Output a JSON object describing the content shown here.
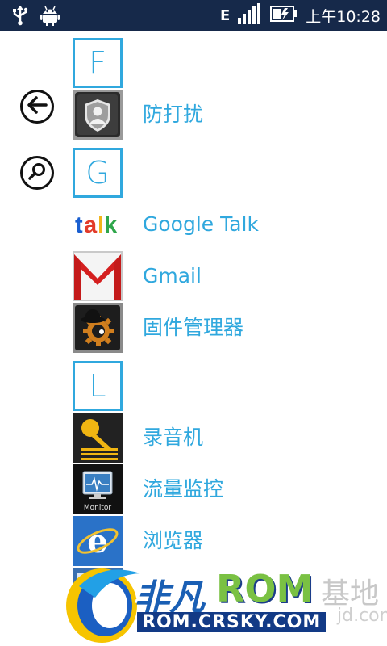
{
  "status_bar": {
    "network": "E",
    "time": "上午10:28"
  },
  "nav": {
    "back_icon": "arrow-left-circle",
    "search_icon": "search-circle"
  },
  "app_list": {
    "headers": {
      "F": "F",
      "G": "G",
      "L": "L"
    },
    "apps": [
      {
        "label": "防打扰"
      },
      {
        "label": "Google Talk"
      },
      {
        "label": "Gmail"
      },
      {
        "label": "固件管理器"
      },
      {
        "label": "录音机"
      },
      {
        "label": "流量监控"
      },
      {
        "label": "浏览器"
      }
    ],
    "talk_logo": {
      "t": "t",
      "a": "a",
      "l": "l",
      "k": "k"
    },
    "monitor_caption": "Monitor"
  },
  "watermark": {
    "brand_cn": "非凡",
    "brand_en": "ROM",
    "url": "ROM.CRSKY.COM",
    "side_text": "基地",
    "side_small": "jd.com"
  },
  "colors": {
    "accent": "#30a8de",
    "status_bar": "#16294a"
  }
}
